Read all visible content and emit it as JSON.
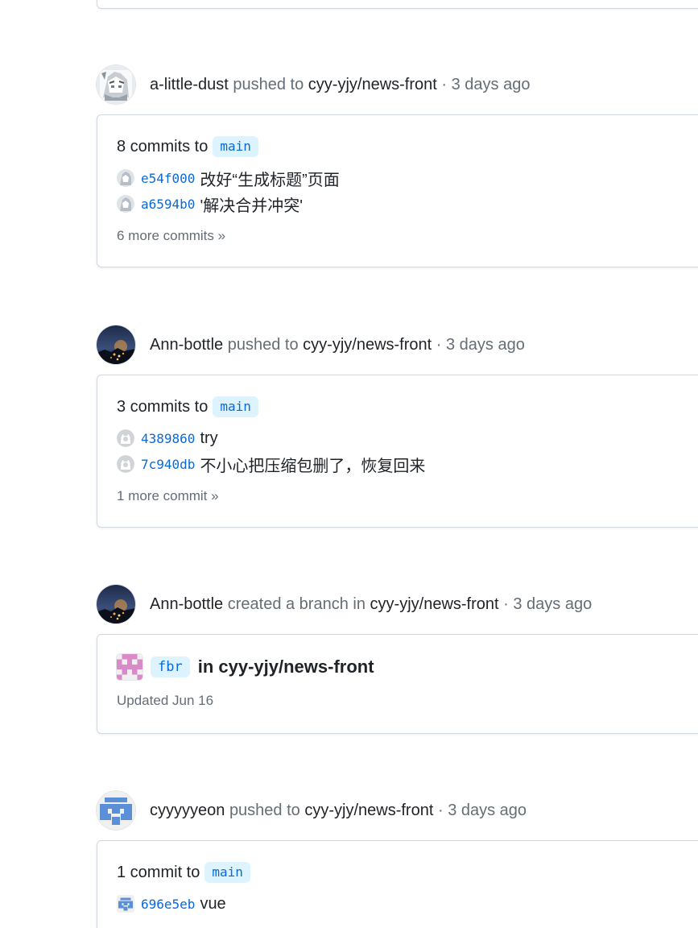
{
  "events": [
    {
      "actor": "a-little-dust",
      "verb": "pushed to",
      "repo": "cyy-yjy/news-front",
      "separator": "·",
      "time": "3 days ago",
      "summary_text": "8 commits to",
      "branch": "main",
      "commits": [
        {
          "sha": "e54f000",
          "message": "改好“生成标题”页面"
        },
        {
          "sha": "a6594b0",
          "message": "'解决合并冲突'"
        }
      ],
      "more_link": "6 more commits »"
    },
    {
      "actor": "Ann-bottle",
      "verb": "pushed to",
      "repo": "cyy-yjy/news-front",
      "separator": "·",
      "time": "3 days ago",
      "summary_text": "3 commits to",
      "branch": "main",
      "commits": [
        {
          "sha": "4389860",
          "message": "try"
        },
        {
          "sha": "7c940db",
          "message": "不小心把压缩包删了，恢复回来"
        }
      ],
      "more_link": "1 more commit »"
    },
    {
      "actor": "Ann-bottle",
      "verb": "created a branch in",
      "repo": "cyy-yjy/news-front",
      "separator": "·",
      "time": "3 days ago",
      "branch": "fbr",
      "branch_in_text": "in cyy-yjy/news-front",
      "updated": "Updated Jun 16"
    },
    {
      "actor": "cyyyyyeon",
      "verb": "pushed to",
      "repo": "cyy-yjy/news-front",
      "separator": "·",
      "time": "3 days ago",
      "summary_text": "1 commit to",
      "branch": "main",
      "commits": [
        {
          "sha": "696e5eb",
          "message": "vue"
        }
      ]
    }
  ],
  "colors": {
    "link_blue": "#0969da",
    "pill_bg": "#ddf4ff",
    "muted": "#656d76",
    "border": "#d0d7de"
  },
  "icons": {
    "avatar_1": "manga-character-avatar",
    "avatar_2": "night-city-avatar",
    "avatar_3": "blue-identicon-avatar",
    "branch_identicon": "pink-identicon",
    "mini_avatar_ann": "github-default-avatar"
  }
}
